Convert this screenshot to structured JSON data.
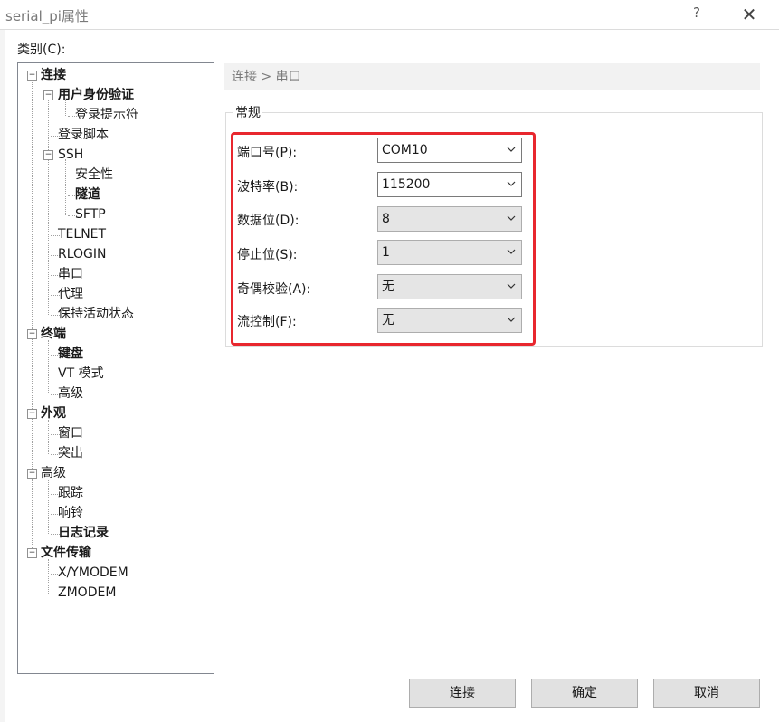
{
  "window": {
    "title": "serial_pi属性",
    "help_glyph": "?",
    "close_glyph": "✕"
  },
  "category_label": "类别(C):",
  "tree": {
    "nodes": [
      {
        "label": "连接"
      },
      {
        "label": "用户身份验证"
      },
      {
        "label": "登录提示符"
      },
      {
        "label": "登录脚本"
      },
      {
        "label": "SSH"
      },
      {
        "label": "安全性"
      },
      {
        "label": "隧道"
      },
      {
        "label": "SFTP"
      },
      {
        "label": "TELNET"
      },
      {
        "label": "RLOGIN"
      },
      {
        "label": "串口"
      },
      {
        "label": "代理"
      },
      {
        "label": "保持活动状态"
      },
      {
        "label": "终端"
      },
      {
        "label": "键盘"
      },
      {
        "label": "VT 模式"
      },
      {
        "label": "高级"
      },
      {
        "label": "外观"
      },
      {
        "label": "窗口"
      },
      {
        "label": "突出"
      },
      {
        "label": "高级"
      },
      {
        "label": "跟踪"
      },
      {
        "label": "响铃"
      },
      {
        "label": "日志记录"
      },
      {
        "label": "文件传输"
      },
      {
        "label": "X/YMODEM"
      },
      {
        "label": "ZMODEM"
      }
    ],
    "expander_glyph": "−"
  },
  "breadcrumb": "连接 > 串口",
  "section_title": "常规",
  "fields": [
    {
      "label": "端口号(P):",
      "value": "COM10"
    },
    {
      "label": "波特率(B):",
      "value": "115200"
    },
    {
      "label": "数据位(D):",
      "value": "8"
    },
    {
      "label": "停止位(S):",
      "value": "1"
    },
    {
      "label": "奇偶校验(A):",
      "value": "无"
    },
    {
      "label": "流控制(F):",
      "value": "无"
    }
  ],
  "buttons": {
    "connect": "连接",
    "ok": "确定",
    "cancel": "取消"
  },
  "colors": {
    "highlight_border": "#e8272e",
    "breadcrumb_bg": "#f2f2f2"
  }
}
